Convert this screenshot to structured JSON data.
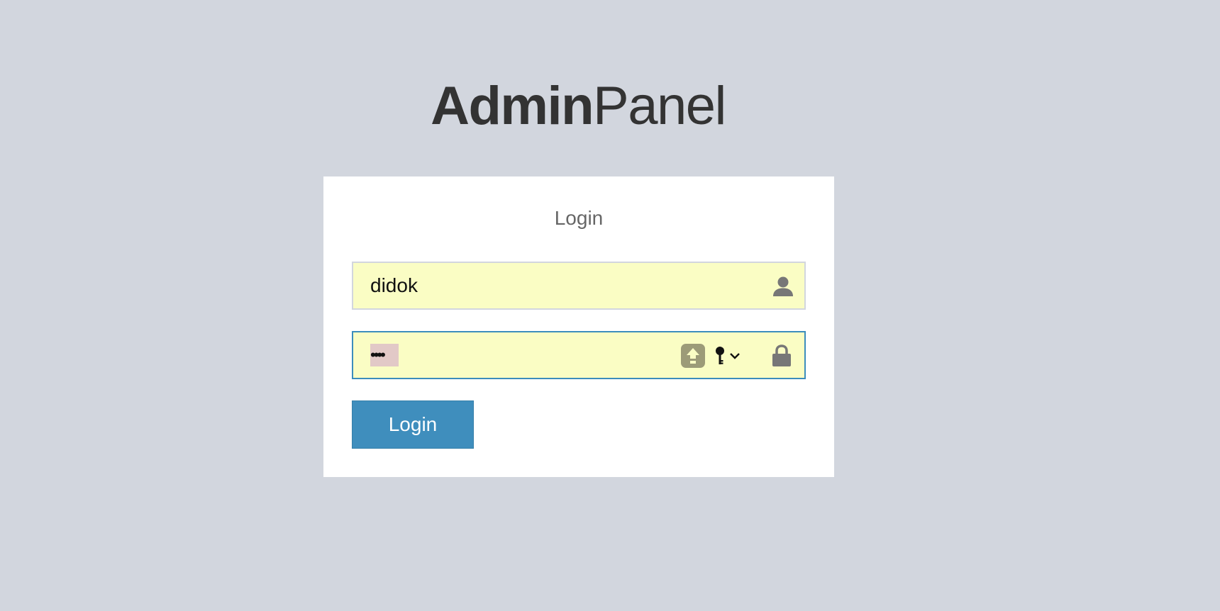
{
  "logo": {
    "strong": "Admin",
    "light": "Panel"
  },
  "login_box": {
    "title": "Login",
    "username": {
      "value": "didok",
      "icon": "user-icon"
    },
    "password": {
      "masked_value": "••••",
      "icons": [
        "capslock-icon",
        "key-icon",
        "lock-icon"
      ]
    },
    "button_label": "Login"
  },
  "colors": {
    "background": "#d2d6de",
    "box": "#ffffff",
    "autofill": "#fafdc4",
    "primary": "#3f8ebd",
    "focus_border": "#3c8dbc"
  }
}
